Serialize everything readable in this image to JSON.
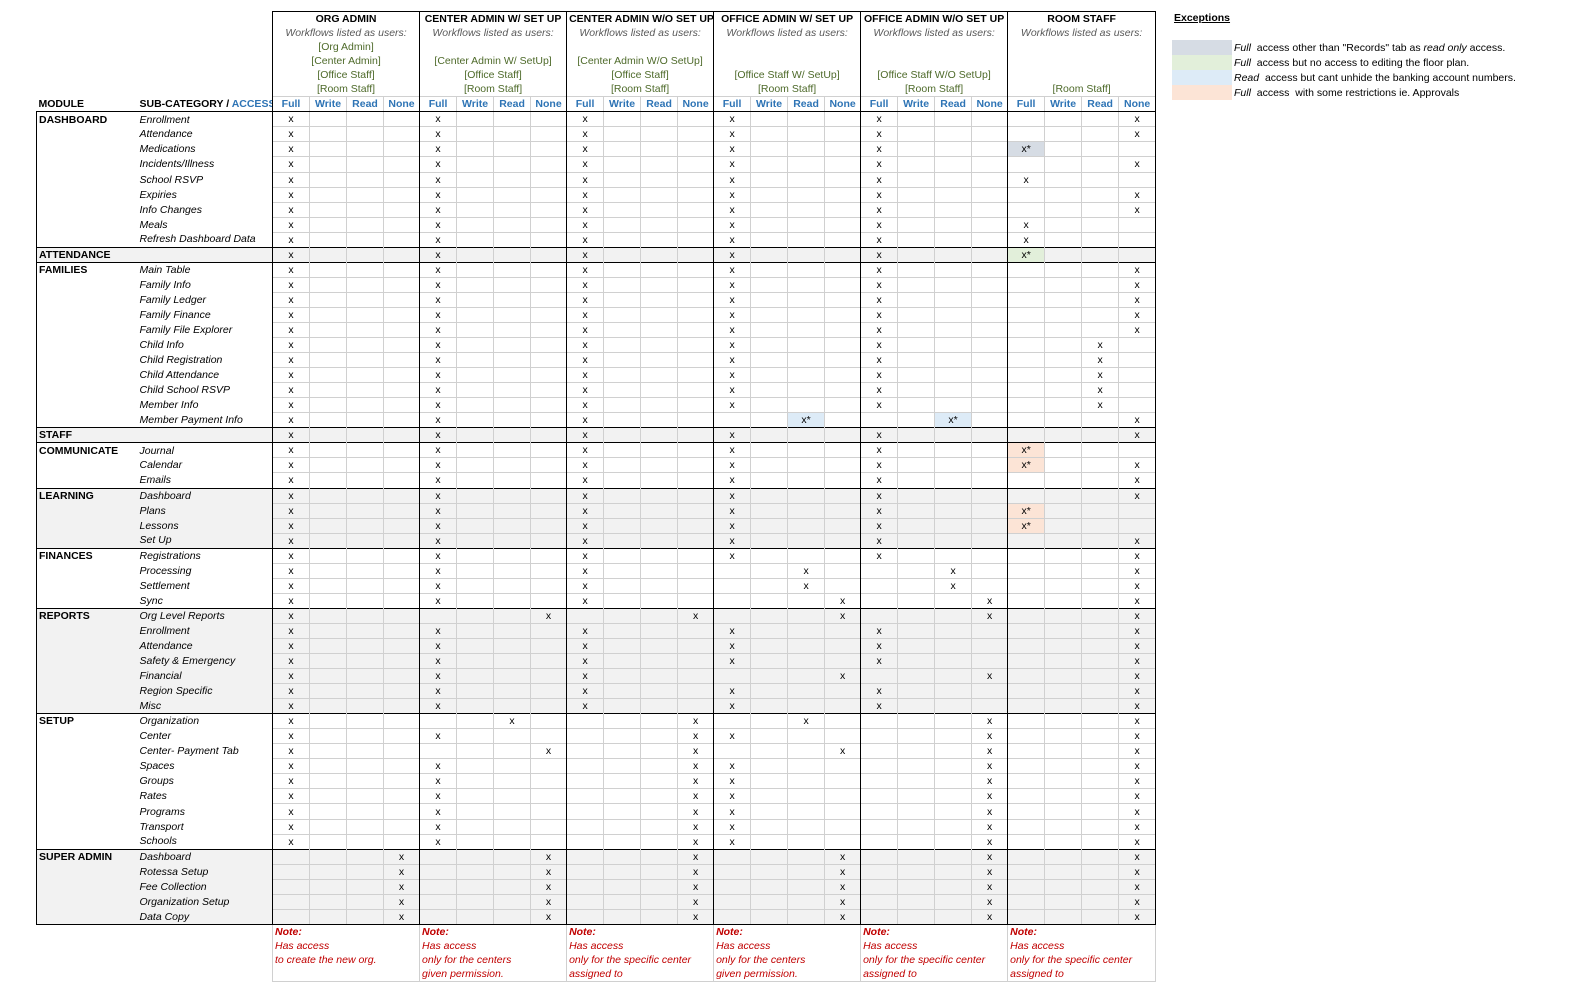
{
  "sheet": {
    "module_header": "MODULE",
    "subcategory_header": "SUB-CATEGORY / ",
    "access_header": "ACCESS",
    "workflow_label": "Workflows listed as users:",
    "access_levels": [
      "Full",
      "Write",
      "Read",
      "None"
    ],
    "roles": [
      {
        "title": "ORG ADMIN",
        "users": [
          "[Org Admin]",
          "[Center Admin]",
          "[Office Staff]",
          "[Room Staff]"
        ],
        "note": [
          "Note:",
          "Has access",
          "to create the new org.",
          ""
        ]
      },
      {
        "title": "CENTER ADMIN W/ SET UP",
        "users": [
          "",
          "[Center Admin W/ SetUp]",
          "[Office Staff]",
          "[Room Staff]"
        ],
        "note": [
          "Note:",
          "Has access",
          "only for the centers",
          "given permission."
        ]
      },
      {
        "title": "CENTER ADMIN W/O SET UP",
        "users": [
          "",
          "[Center Admin W/O SetUp]",
          "[Office Staff]",
          "[Room Staff]"
        ],
        "note": [
          "Note:",
          "Has access",
          "only for the specific center",
          "assigned to"
        ]
      },
      {
        "title": "OFFICE ADMIN W/ SET UP",
        "users": [
          "",
          "",
          "[Office Staff W/ SetUp]",
          "[Room Staff]"
        ],
        "note": [
          "Note:",
          "Has access",
          "only for the centers",
          "given permission."
        ]
      },
      {
        "title": "OFFICE ADMIN W/O SET UP",
        "users": [
          "",
          "",
          "[Office Staff W/O SetUp]",
          "[Room Staff]"
        ],
        "note": [
          "Note:",
          "Has access",
          "only for the specific center",
          "assigned to"
        ]
      },
      {
        "title": "ROOM STAFF",
        "users": [
          "",
          "",
          "",
          "[Room Staff]"
        ],
        "note": [
          "Note:",
          "Has access",
          "only for the specific center",
          "assigned to"
        ]
      }
    ],
    "modules": [
      {
        "name": "DASHBOARD",
        "rows": [
          {
            "sub": "Enrollment",
            "m": [
              "0",
              "0",
              "0",
              "0",
              "0",
              "3"
            ]
          },
          {
            "sub": "Attendance",
            "m": [
              "0",
              "0",
              "0",
              "0",
              "0",
              "3"
            ]
          },
          {
            "sub": "Medications",
            "m": [
              "0",
              "0",
              "0",
              "0",
              "0",
              "0*g"
            ]
          },
          {
            "sub": "Incidents/Illness",
            "m": [
              "0",
              "0",
              "0",
              "0",
              "0",
              "3"
            ]
          },
          {
            "sub": "School RSVP",
            "m": [
              "0",
              "0",
              "0",
              "0",
              "0",
              "0"
            ]
          },
          {
            "sub": "Expiries",
            "m": [
              "0",
              "0",
              "0",
              "0",
              "0",
              "3"
            ]
          },
          {
            "sub": "Info Changes",
            "m": [
              "0",
              "0",
              "0",
              "0",
              "0",
              "3"
            ]
          },
          {
            "sub": "Meals",
            "m": [
              "0",
              "0",
              "0",
              "0",
              "0",
              "0"
            ]
          },
          {
            "sub": "Refresh Dashboard Data",
            "m": [
              "0",
              "0",
              "0",
              "0",
              "0",
              "0"
            ]
          }
        ]
      },
      {
        "name": "ATTENDANCE",
        "rows": [
          {
            "sub": "",
            "m": [
              "0",
              "0",
              "0",
              "0",
              "0",
              "0*gr"
            ]
          }
        ]
      },
      {
        "name": "FAMILIES",
        "rows": [
          {
            "sub": "Main Table",
            "m": [
              "0",
              "0",
              "0",
              "0",
              "0",
              "3"
            ]
          },
          {
            "sub": "Family Info",
            "m": [
              "0",
              "0",
              "0",
              "0",
              "0",
              "3"
            ]
          },
          {
            "sub": "Family Ledger",
            "m": [
              "0",
              "0",
              "0",
              "0",
              "0",
              "3"
            ]
          },
          {
            "sub": "Family Finance",
            "m": [
              "0",
              "0",
              "0",
              "0",
              "0",
              "3"
            ]
          },
          {
            "sub": "Family File Explorer",
            "m": [
              "0",
              "0",
              "0",
              "0",
              "0",
              "3"
            ]
          },
          {
            "sub": "Child Info",
            "m": [
              "0",
              "0",
              "0",
              "0",
              "0",
              "2"
            ]
          },
          {
            "sub": "Child Registration",
            "m": [
              "0",
              "0",
              "0",
              "0",
              "0",
              "2"
            ]
          },
          {
            "sub": "Child Attendance",
            "m": [
              "0",
              "0",
              "0",
              "0",
              "0",
              "2"
            ]
          },
          {
            "sub": "Child School RSVP",
            "m": [
              "0",
              "0",
              "0",
              "0",
              "0",
              "2"
            ]
          },
          {
            "sub": "Member Info",
            "m": [
              "0",
              "0",
              "0",
              "0",
              "0",
              "2"
            ]
          },
          {
            "sub": "Member Payment Info",
            "m": [
              "0",
              "0",
              "0",
              "2*b",
              "2*b",
              "3"
            ]
          }
        ]
      },
      {
        "name": "STAFF",
        "rows": [
          {
            "sub": "",
            "m": [
              "0",
              "0",
              "0",
              "0",
              "0",
              "3"
            ]
          }
        ]
      },
      {
        "name": "COMMUNICATE",
        "rows": [
          {
            "sub": "Journal",
            "m": [
              "0",
              "0",
              "0",
              "0",
              "0",
              "0*p"
            ]
          },
          {
            "sub": "Calendar",
            "m": [
              "0",
              "0",
              "0",
              "0",
              "0",
              "0*p;3"
            ]
          },
          {
            "sub": "Emails",
            "m": [
              "0",
              "0",
              "0",
              "0",
              "0",
              "3"
            ]
          }
        ]
      },
      {
        "name": "LEARNING",
        "rows": [
          {
            "sub": "Dashboard",
            "m": [
              "0",
              "0",
              "0",
              "0",
              "0",
              "3"
            ]
          },
          {
            "sub": "Plans",
            "m": [
              "0",
              "0",
              "0",
              "0",
              "0",
              "0*p"
            ]
          },
          {
            "sub": "Lessons",
            "m": [
              "0",
              "0",
              "0",
              "0",
              "0",
              "0*p"
            ]
          },
          {
            "sub": "Set Up",
            "m": [
              "0",
              "0",
              "0",
              "0",
              "0",
              "3"
            ]
          }
        ]
      },
      {
        "name": "FINANCES",
        "rows": [
          {
            "sub": "Registrations",
            "m": [
              "0",
              "0",
              "0",
              "0",
              "0",
              "3"
            ]
          },
          {
            "sub": "Processing",
            "m": [
              "0",
              "0",
              "0",
              "2",
              "2",
              "3"
            ]
          },
          {
            "sub": "Settlement",
            "m": [
              "0",
              "0",
              "0",
              "2",
              "2",
              "3"
            ]
          },
          {
            "sub": "Sync",
            "m": [
              "0",
              "0",
              "0",
              "3",
              "3",
              "3"
            ]
          }
        ]
      },
      {
        "name": "REPORTS",
        "rows": [
          {
            "sub": "Org Level Reports",
            "m": [
              "0",
              "3",
              "3",
              "3",
              "3",
              "3"
            ]
          },
          {
            "sub": "Enrollment",
            "m": [
              "0",
              "0",
              "0",
              "0",
              "0",
              "3"
            ]
          },
          {
            "sub": "Attendance",
            "m": [
              "0",
              "0",
              "0",
              "0",
              "0",
              "3"
            ]
          },
          {
            "sub": "Safety & Emergency",
            "m": [
              "0",
              "0",
              "0",
              "0",
              "0",
              "3"
            ]
          },
          {
            "sub": "Financial",
            "m": [
              "0",
              "0",
              "0",
              "3",
              "3",
              "3"
            ]
          },
          {
            "sub": "Region Specific",
            "m": [
              "0",
              "0",
              "0",
              "0",
              "0",
              "3"
            ]
          },
          {
            "sub": "Misc",
            "m": [
              "0",
              "0",
              "0",
              "0",
              "0",
              "3"
            ]
          }
        ]
      },
      {
        "name": "SETUP",
        "rows": [
          {
            "sub": "Organization",
            "m": [
              "0",
              "2",
              "3",
              "2",
              "3",
              "3"
            ]
          },
          {
            "sub": "Center",
            "m": [
              "0",
              "0",
              "3",
              "0",
              "3",
              "3"
            ]
          },
          {
            "sub": "Center- Payment Tab",
            "m": [
              "0",
              "3",
              "3",
              "3",
              "3",
              "3"
            ]
          },
          {
            "sub": "Spaces",
            "m": [
              "0",
              "0",
              "3",
              "0",
              "3",
              "3"
            ]
          },
          {
            "sub": "Groups",
            "m": [
              "0",
              "0",
              "3",
              "0",
              "3",
              "3"
            ]
          },
          {
            "sub": "Rates",
            "m": [
              "0",
              "0",
              "3",
              "0",
              "3",
              "3"
            ]
          },
          {
            "sub": "Programs",
            "m": [
              "0",
              "0",
              "3",
              "0",
              "3",
              "3"
            ]
          },
          {
            "sub": "Transport",
            "m": [
              "0",
              "0",
              "3",
              "0",
              "3",
              "3"
            ]
          },
          {
            "sub": "Schools",
            "m": [
              "0",
              "0",
              "3",
              "0",
              "3",
              "3"
            ]
          }
        ]
      },
      {
        "name": "SUPER ADMIN",
        "rows": [
          {
            "sub": "Dashboard",
            "m": [
              "3",
              "3",
              "3",
              "3",
              "3",
              "3"
            ]
          },
          {
            "sub": "Rotessa Setup",
            "m": [
              "3",
              "3",
              "3",
              "3",
              "3",
              "3"
            ]
          },
          {
            "sub": "Fee Collection",
            "m": [
              "3",
              "3",
              "3",
              "3",
              "3",
              "3"
            ]
          },
          {
            "sub": "Organization Setup",
            "m": [
              "3",
              "3",
              "3",
              "3",
              "3",
              "3"
            ]
          },
          {
            "sub": "Data Copy",
            "m": [
              "3",
              "3",
              "3",
              "3",
              "3",
              "3"
            ]
          }
        ]
      }
    ],
    "mark_symbol": "x",
    "mark_star_symbol": "x*",
    "colors": {
      "grey": "#d6dce4",
      "green": "#e2efda",
      "blue": "#ddebf7",
      "peach": "#fce4d6",
      "note_red": "#c00000",
      "access_blue": "#2e74b5",
      "user_green": "#4e6a2a"
    }
  },
  "legend": {
    "title": "Exceptions",
    "items": [
      {
        "color": "grey",
        "lead": "Full",
        "text": "  access other than \"Records\" tab as ",
        "em": "read only",
        "tail": " access."
      },
      {
        "color": "green",
        "lead": "Full",
        "text": "  access but no access to editing the floor plan.",
        "em": "",
        "tail": ""
      },
      {
        "color": "blue",
        "lead": "Read",
        "text": "  access but cant unhide the banking account numbers.",
        "em": "",
        "tail": ""
      },
      {
        "color": "peach",
        "lead": "Full",
        "text": "  access  with some restrictions ie. Approvals",
        "em": "",
        "tail": ""
      }
    ]
  }
}
